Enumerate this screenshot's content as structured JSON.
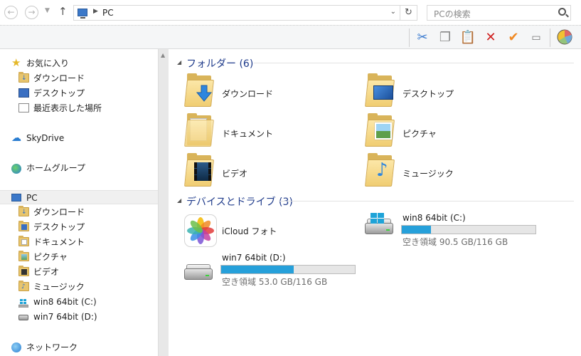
{
  "address": {
    "path": "PC",
    "search_placeholder": "PCの検索"
  },
  "sidebar": {
    "favorites": {
      "label": "お気に入り",
      "items": [
        {
          "label": "ダウンロード"
        },
        {
          "label": "デスクトップ"
        },
        {
          "label": "最近表示した場所"
        }
      ]
    },
    "skydrive": "SkyDrive",
    "homegroup": "ホームグループ",
    "pc": {
      "label": "PC",
      "items": [
        {
          "label": "ダウンロード"
        },
        {
          "label": "デスクトップ"
        },
        {
          "label": "ドキュメント"
        },
        {
          "label": "ピクチャ"
        },
        {
          "label": "ビデオ"
        },
        {
          "label": "ミュージック"
        },
        {
          "label": "win8 64bit (C:)"
        },
        {
          "label": "win7 64bit (D:)"
        }
      ]
    },
    "network": "ネットワーク"
  },
  "main": {
    "folders_header": "フォルダー (6)",
    "folders": [
      {
        "label": "ダウンロード",
        "icon": "download-folder-icon"
      },
      {
        "label": "デスクトップ",
        "icon": "desktop-folder-icon"
      },
      {
        "label": "ドキュメント",
        "icon": "documents-folder-icon"
      },
      {
        "label": "ピクチャ",
        "icon": "pictures-folder-icon"
      },
      {
        "label": "ビデオ",
        "icon": "videos-folder-icon"
      },
      {
        "label": "ミュージック",
        "icon": "music-folder-icon"
      }
    ],
    "devices_header": "デバイスとドライブ (3)",
    "icloud": "iCloud フォト",
    "drives": [
      {
        "name": "win8 64bit (C:)",
        "info": "空き領域 90.5 GB/116 GB",
        "used_fraction": 0.22
      },
      {
        "name": "win7 64bit (D:)",
        "info": "空き領域 53.0 GB/116 GB",
        "used_fraction": 0.54
      }
    ]
  },
  "colors": {
    "accent": "#26a0da",
    "header_text": "#1e3a8a"
  }
}
